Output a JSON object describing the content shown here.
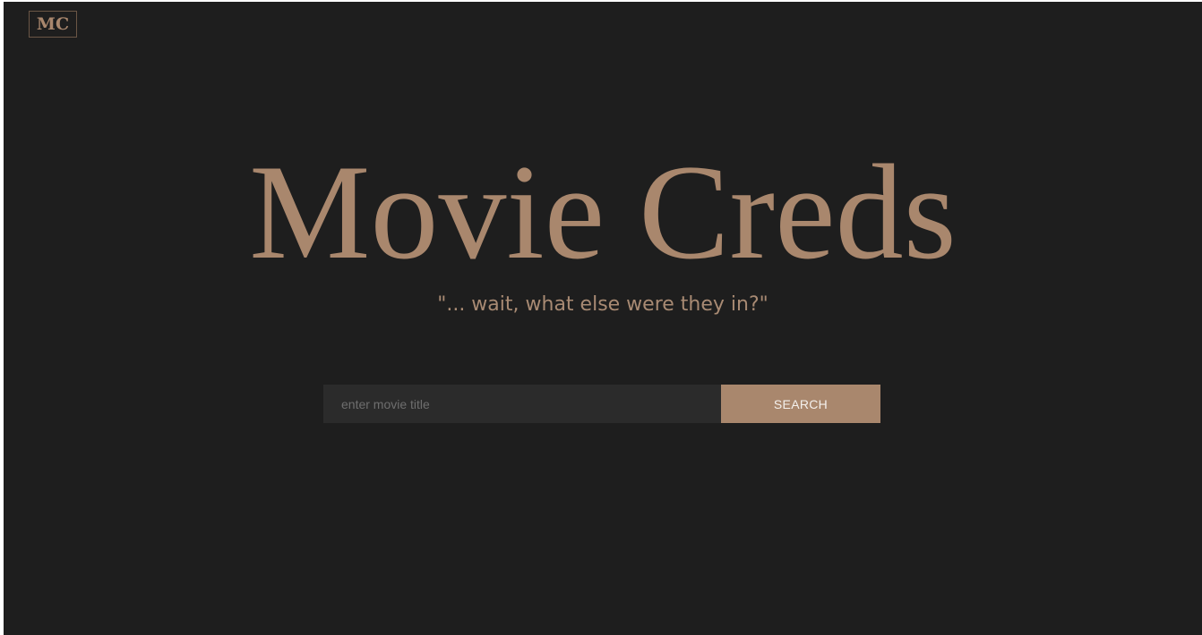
{
  "logo": {
    "text": "MC"
  },
  "hero": {
    "title": "Movie Creds",
    "tagline": "\"... wait, what else were they in?\""
  },
  "search": {
    "placeholder": "enter movie title",
    "value": "",
    "button_label": "SEARCH"
  },
  "colors": {
    "background": "#1e1e1e",
    "accent": "#a9876d",
    "input_background": "#2b2b2b",
    "button_text": "#f4f0ec"
  }
}
